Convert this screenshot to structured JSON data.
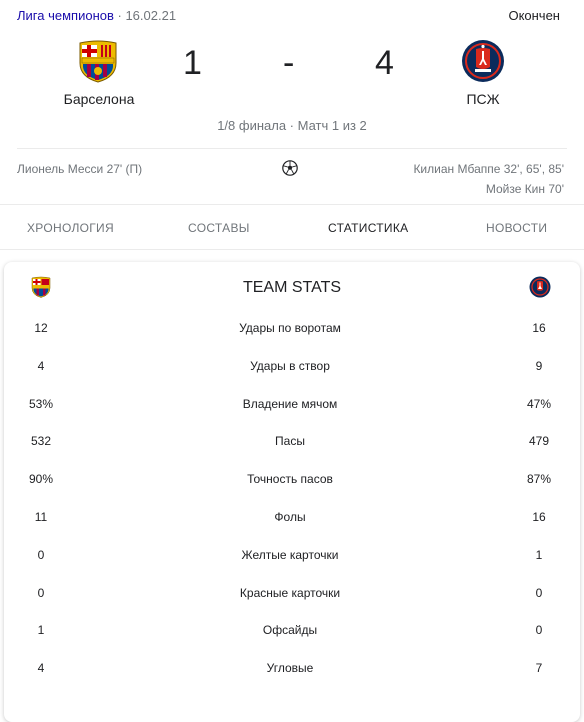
{
  "header": {
    "league": "Лига чемпионов",
    "date": "· 16.02.21",
    "status": "Окончен"
  },
  "match": {
    "home": {
      "name": "Барселона",
      "score": "1",
      "crest": "barcelona-crest"
    },
    "separator": "-",
    "away": {
      "name": "ПСЖ",
      "score": "4",
      "crest": "psg-crest"
    },
    "stage": "1/8 финала · Матч 1 из 2"
  },
  "goals": {
    "home": [
      "Лионель Месси 27' (П)"
    ],
    "away": [
      "Килиан Мбаппе 32', 65', 85'",
      "Мойзе Кин 70'"
    ],
    "icon": "soccer-ball-icon"
  },
  "tabs": [
    "Хронология",
    "Составы",
    "Статистика",
    "Новости"
  ],
  "stats": {
    "title": "TEAM STATS",
    "rows": [
      {
        "home": "12",
        "label": "Удары по воротам",
        "away": "16"
      },
      {
        "home": "4",
        "label": "Удары в створ",
        "away": "9"
      },
      {
        "home": "53%",
        "label": "Владение мячом",
        "away": "47%"
      },
      {
        "home": "532",
        "label": "Пасы",
        "away": "479"
      },
      {
        "home": "90%",
        "label": "Точность пасов",
        "away": "87%"
      },
      {
        "home": "11",
        "label": "Фолы",
        "away": "16"
      },
      {
        "home": "0",
        "label": "Желтые карточки",
        "away": "1"
      },
      {
        "home": "0",
        "label": "Красные карточки",
        "away": "0"
      },
      {
        "home": "1",
        "label": "Офсайды",
        "away": "0"
      },
      {
        "home": "4",
        "label": "Угловые",
        "away": "7"
      }
    ]
  },
  "colors": {
    "link": "#1a0dab",
    "muted": "#70757a",
    "barca_blue": "#004d98",
    "barca_red": "#a50044",
    "psg_navy": "#0b2b5c",
    "psg_red": "#da291c"
  }
}
